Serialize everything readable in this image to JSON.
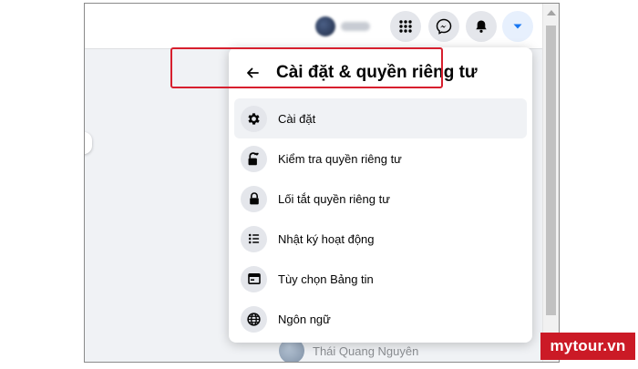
{
  "topbar": {
    "icons": [
      "menu-grid-icon",
      "messenger-icon",
      "notification-bell-icon",
      "account-caret-icon"
    ],
    "accent_color": "#1877f2"
  },
  "background": {
    "contact_name": "Thái Quang Nguyên"
  },
  "dropdown": {
    "title": "Cài đặt & quyền riêng tư",
    "items": [
      {
        "label": "Cài đặt",
        "icon": "gear-icon",
        "selected": true
      },
      {
        "label": "Kiểm tra quyền riêng tư",
        "icon": "privacy-lock-heart-icon",
        "selected": false
      },
      {
        "label": "Lối tắt quyền riêng tư",
        "icon": "lock-icon",
        "selected": false
      },
      {
        "label": "Nhật ký hoạt động",
        "icon": "list-icon",
        "selected": false
      },
      {
        "label": "Tùy chọn Bảng tin",
        "icon": "news-feed-icon",
        "selected": false
      },
      {
        "label": "Ngôn ngữ",
        "icon": "globe-icon",
        "selected": false
      }
    ]
  },
  "annotation": {
    "highlight_color": "#d71f2e"
  },
  "watermark": {
    "text": "mytour.vn",
    "color": "#cb1a26"
  }
}
